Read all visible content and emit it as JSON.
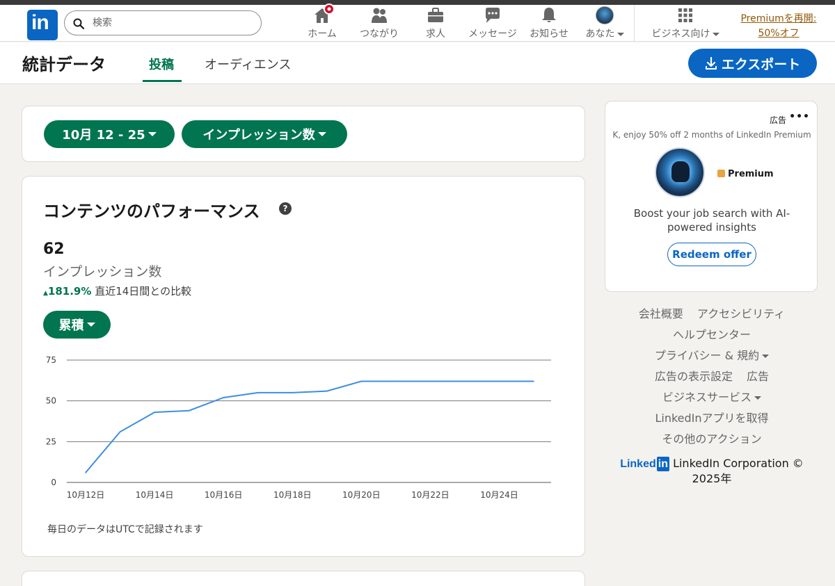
{
  "nav": {
    "logo_text": "in",
    "search_placeholder": "検索",
    "items": [
      {
        "label": "ホーム"
      },
      {
        "label": "つながり"
      },
      {
        "label": "求人"
      },
      {
        "label": "メッセージ"
      },
      {
        "label": "お知らせ"
      },
      {
        "label": "あなた"
      },
      {
        "label": "ビジネス向け"
      }
    ],
    "premium_line1": "Premiumを再開:",
    "premium_line2": "50%オフ"
  },
  "subheader": {
    "title": "統計データ",
    "tabs": [
      {
        "label": "投稿"
      },
      {
        "label": "オーディエンス"
      }
    ],
    "export_label": "エクスポート"
  },
  "filters": {
    "date_range": "10月 12 - 25",
    "metric": "インプレッション数"
  },
  "performance": {
    "title": "コンテンツのパフォーマンス",
    "help": "?",
    "value": "62",
    "metric_label": "インプレッション数",
    "change": "181.9%",
    "change_note": "直近14日間との比較",
    "mode": "累積",
    "footnote": "毎日のデータはUTCで記録されます"
  },
  "chart_data": {
    "type": "line",
    "x": [
      "10月12日",
      "10月13日",
      "10月14日",
      "10月15日",
      "10月16日",
      "10月17日",
      "10月18日",
      "10月19日",
      "10月20日",
      "10月21日",
      "10月22日",
      "10月23日",
      "10月24日",
      "10月25日"
    ],
    "xtick_labels": [
      "10月12日",
      "10月14日",
      "10月16日",
      "10月18日",
      "10月20日",
      "10月22日",
      "10月24日"
    ],
    "series": [
      {
        "values": [
          6,
          31,
          43,
          44,
          52,
          55,
          55,
          56,
          62,
          62,
          62,
          62,
          62,
          62
        ],
        "color": "#3b8fe0"
      }
    ],
    "yticks": [
      0,
      25,
      50,
      75
    ],
    "ylim": [
      0,
      75
    ],
    "grid": true
  },
  "ad": {
    "label": "広告",
    "more": "•••",
    "subtitle": "K, enjoy 50% off 2 months of LinkedIn Premium",
    "premium_tag": "Premium",
    "body": "Boost your job search with AI-powered insights",
    "cta": "Redeem offer"
  },
  "footer": {
    "links": [
      [
        "会社概要",
        "アクセシビリティ"
      ],
      [
        "ヘルプセンター"
      ],
      [
        "プライバシー & 規約"
      ],
      [
        "広告の表示設定",
        "広告"
      ],
      [
        "ビジネスサービス"
      ],
      [
        "LinkedInアプリを取得"
      ],
      [
        "その他のアクション"
      ]
    ],
    "brand_text": "Linked",
    "brand_box": "in",
    "corp": "LinkedIn Corporation © 2025年"
  }
}
